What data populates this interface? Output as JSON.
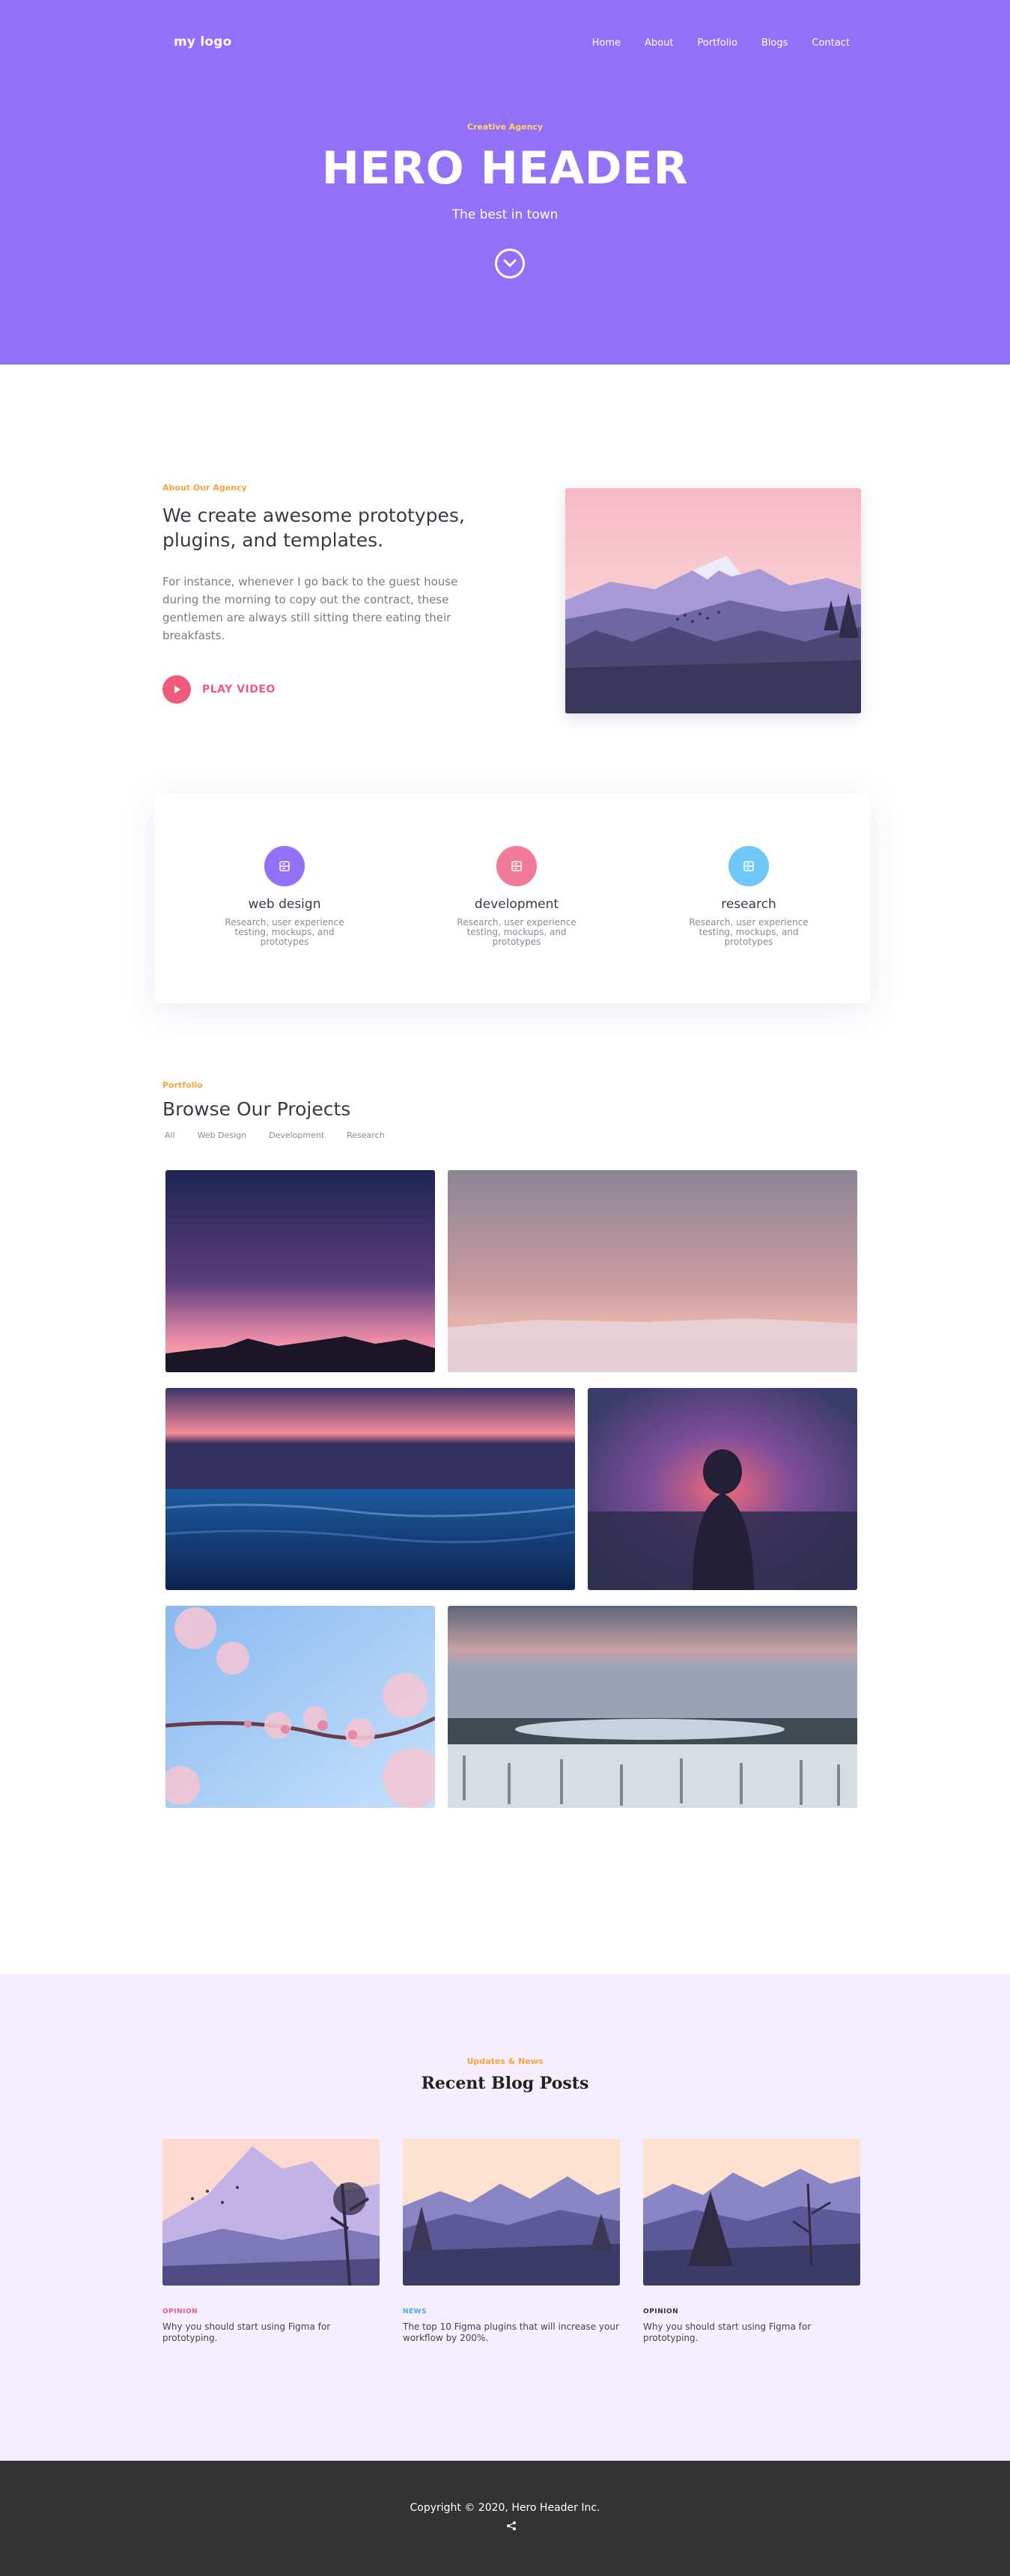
{
  "nav": {
    "logo": "my logo",
    "links": [
      "Home",
      "About",
      "Portfolio",
      "Blogs",
      "Contact"
    ]
  },
  "hero": {
    "eyebrow": "Creative Agency",
    "title": "HERO HEADER",
    "subtitle": "The best in town",
    "scroll_icon": "chevron-down-icon"
  },
  "about": {
    "eyebrow": "About Our Agency",
    "heading": "We create awesome prototypes, plugins, and templates.",
    "body": "For instance, whenever I go back to the guest house during the morning to copy out the contract, these gentlemen are always still sitting there eating their breakfasts.",
    "play_label": "PLAY VIDEO"
  },
  "services": [
    {
      "title": "web design",
      "desc": "Research, user experience testing, mockups, and prototypes",
      "color": "#9370f8"
    },
    {
      "title": "development",
      "desc": "Research, user experience testing, mockups, and prototypes",
      "color": "#f27a9a"
    },
    {
      "title": "research",
      "desc": "Research, user experience testing, mockups, and prototypes",
      "color": "#6ec7f8"
    }
  ],
  "portfolio": {
    "eyebrow": "Portfolio",
    "heading": "Browse Our Projects",
    "filters": [
      "All",
      "Web Design",
      "Development",
      "Research"
    ]
  },
  "blog": {
    "eyebrow": "Updates & News",
    "heading": "Recent Blog Posts",
    "posts": [
      {
        "tag": "OPINION",
        "tag_color": "#f25a7c",
        "title": "Why you should start using Figma for prototyping."
      },
      {
        "tag": "NEWS",
        "tag_color": "#4aa8f0",
        "title": "The top 10 Figma plugins that will increase your workflow by 200%."
      },
      {
        "tag": "OPINION",
        "tag_color": "#333333",
        "title": "Why you should start using Figma for prototyping."
      }
    ]
  },
  "footer": {
    "copyright": "Copyright © 2020, Hero Header Inc."
  },
  "colors": {
    "hero_bg": "#9370f8",
    "accent_orange": "#f7a43b",
    "accent_pink": "#f25a7c",
    "blog_bg": "#f5eefe",
    "footer_bg": "#333333"
  }
}
